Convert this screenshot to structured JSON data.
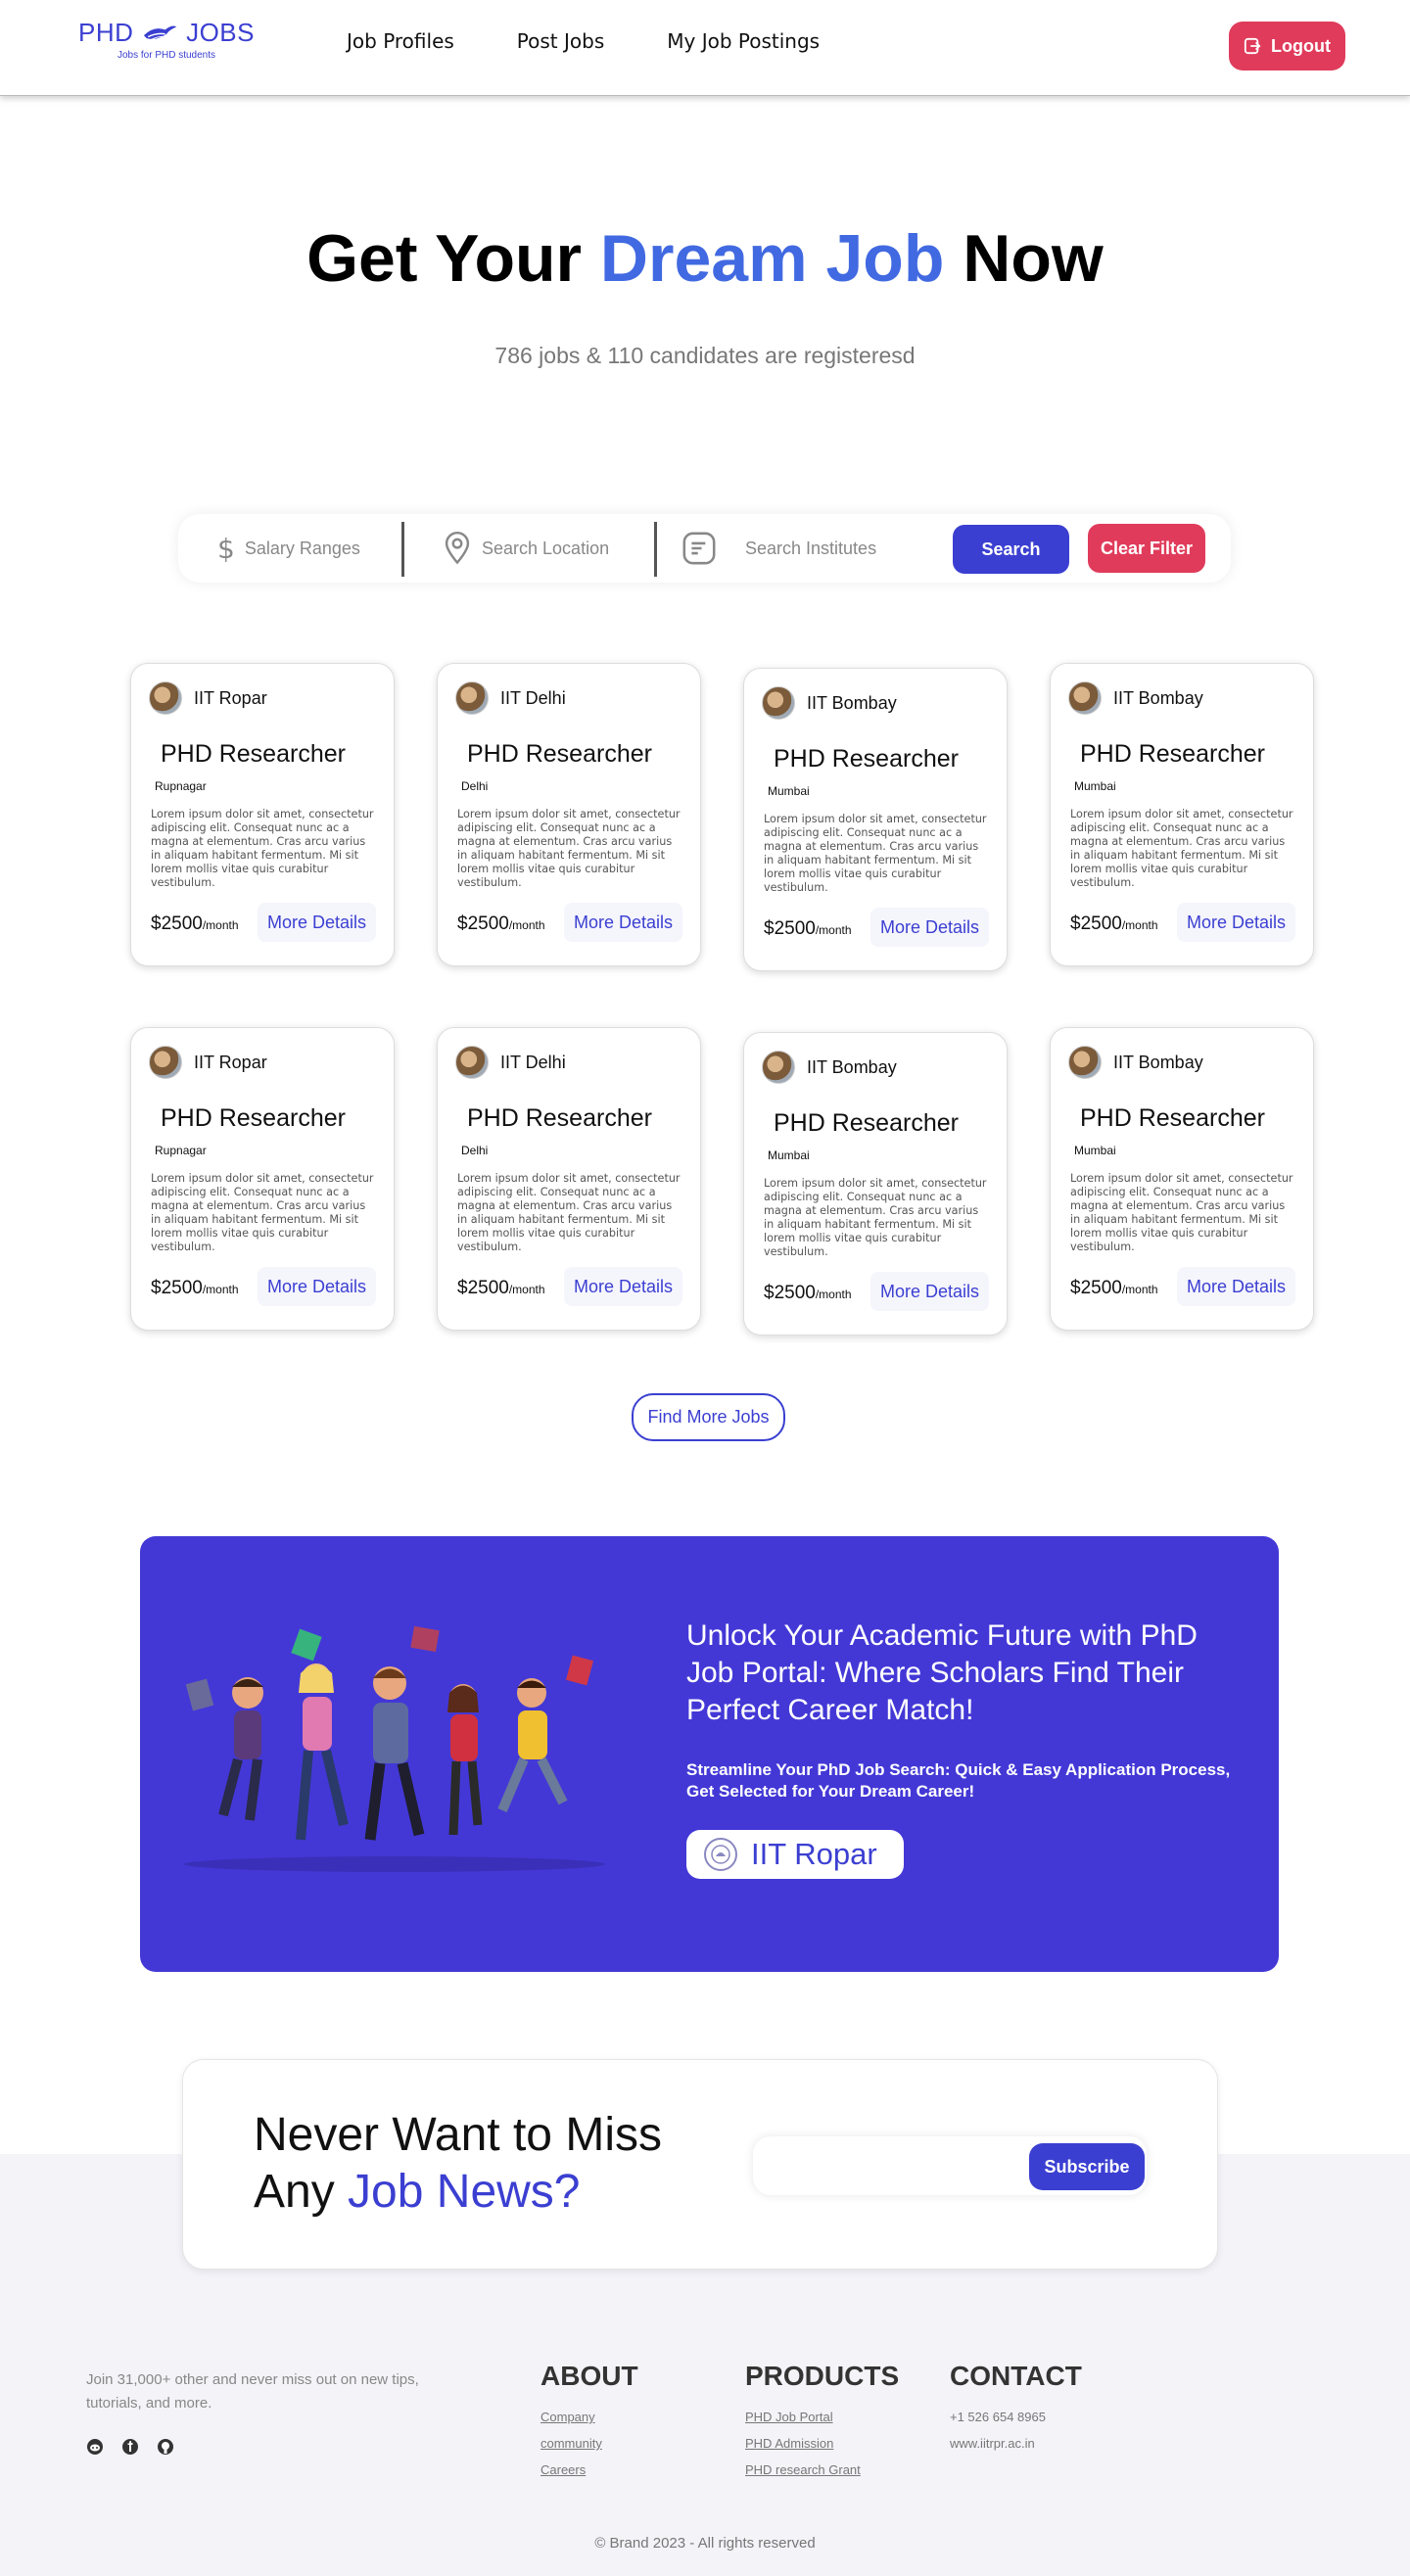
{
  "nav": {
    "logo_text_left": "PHD",
    "logo_text_right": "JOBS",
    "logo_tagline": "Jobs for PHD students",
    "links": [
      "Job Profiles",
      "Post Jobs",
      "My Job Postings"
    ],
    "logout_label": "Logout"
  },
  "hero": {
    "title_pre": "Get Your ",
    "title_accent": "Dream Job",
    "title_post": " Now",
    "subtitle": "786 jobs & 110 candidates are registeresd"
  },
  "search": {
    "salary_placeholder": "Salary Ranges",
    "location_placeholder": "Search Location",
    "institute_placeholder": "Search Institutes",
    "search_label": "Search",
    "clear_label": "Clear Filter"
  },
  "jobs": [
    {
      "institute": "IIT Ropar",
      "title": "PHD Researcher",
      "location": "Rupnagar",
      "description": "Lorem ipsum dolor sit amet, consectetur adipiscing elit. Consequat nunc ac a magna at elementum. Cras arcu varius in aliquam habitant fermentum. Mi sit lorem mollis vitae quis curabitur vestibulum.",
      "salary": "$2500",
      "per": "/month",
      "cta": "More Details"
    },
    {
      "institute": "IIT Delhi",
      "title": "PHD Researcher",
      "location": "Delhi",
      "description": "Lorem ipsum dolor sit amet, consectetur adipiscing elit. Consequat nunc ac a magna at elementum. Cras arcu varius in aliquam habitant fermentum. Mi sit lorem mollis vitae quis curabitur vestibulum.",
      "salary": "$2500",
      "per": "/month",
      "cta": "More Details"
    },
    {
      "institute": "IIT Bombay",
      "title": "PHD Researcher",
      "location": "Mumbai",
      "description": "Lorem ipsum dolor sit amet, consectetur adipiscing elit. Consequat nunc ac a magna at elementum. Cras arcu varius in aliquam habitant fermentum. Mi sit lorem mollis vitae quis curabitur vestibulum.",
      "salary": "$2500",
      "per": "/month",
      "cta": "More Details"
    },
    {
      "institute": "IIT Bombay",
      "title": "PHD Researcher",
      "location": "Mumbai",
      "description": "Lorem ipsum dolor sit amet, consectetur adipiscing elit. Consequat nunc ac a magna at elementum. Cras arcu varius in aliquam habitant fermentum. Mi sit lorem mollis vitae quis curabitur vestibulum.",
      "salary": "$2500",
      "per": "/month",
      "cta": "More Details"
    },
    {
      "institute": "IIT Ropar",
      "title": "PHD Researcher",
      "location": "Rupnagar",
      "description": "Lorem ipsum dolor sit amet, consectetur adipiscing elit. Consequat nunc ac a magna at elementum. Cras arcu varius in aliquam habitant fermentum. Mi sit lorem mollis vitae quis curabitur vestibulum.",
      "salary": "$2500",
      "per": "/month",
      "cta": "More Details"
    },
    {
      "institute": "IIT Delhi",
      "title": "PHD Researcher",
      "location": "Delhi",
      "description": "Lorem ipsum dolor sit amet, consectetur adipiscing elit. Consequat nunc ac a magna at elementum. Cras arcu varius in aliquam habitant fermentum. Mi sit lorem mollis vitae quis curabitur vestibulum.",
      "salary": "$2500",
      "per": "/month",
      "cta": "More Details"
    },
    {
      "institute": "IIT Bombay",
      "title": "PHD Researcher",
      "location": "Mumbai",
      "description": "Lorem ipsum dolor sit amet, consectetur adipiscing elit. Consequat nunc ac a magna at elementum. Cras arcu varius in aliquam habitant fermentum. Mi sit lorem mollis vitae quis curabitur vestibulum.",
      "salary": "$2500",
      "per": "/month",
      "cta": "More Details"
    },
    {
      "institute": "IIT Bombay",
      "title": "PHD Researcher",
      "location": "Mumbai",
      "description": "Lorem ipsum dolor sit amet, consectetur adipiscing elit. Consequat nunc ac a magna at elementum. Cras arcu varius in aliquam habitant fermentum. Mi sit lorem mollis vitae quis curabitur vestibulum.",
      "salary": "$2500",
      "per": "/month",
      "cta": "More Details"
    }
  ],
  "find_more_label": "Find More Jobs",
  "promo": {
    "title": "Unlock Your Academic Future with PhD Job Portal: Where Scholars Find Their Perfect Career Match!",
    "subtitle": "Streamline Your PhD Job Search: Quick & Easy Application Process, Get Selected for Your Dream Career!",
    "badge_label": "IIT Ropar",
    "background_color": "#4338d6"
  },
  "newsletter": {
    "title_line1": "Never Want to Miss",
    "title_line2_pre": "Any ",
    "title_line2_accent": "Job News?",
    "input_value": "",
    "subscribe_label": "Subscribe"
  },
  "footer": {
    "tagline": "Join 31,000+ other and never miss out on new tips, tutorials, and more.",
    "social_icons": [
      "reddit-icon",
      "facebook-icon",
      "github-icon"
    ],
    "about_heading": "ABOUT",
    "about_links": [
      "Company",
      "community",
      "Careers"
    ],
    "products_heading": "PRODUCTS",
    "products_links": [
      "PHD Job Portal",
      "PHD Admission",
      "PHD research Grant"
    ],
    "contact_heading": "CONTACT",
    "contact_phone": "+1 526 654 8965",
    "contact_web": "www.iitrpr.ac.in",
    "copyright": "© Brand 2023 - All rights reserved"
  },
  "colors": {
    "brand_blue": "#3b3fd1",
    "hero_accent": "#4169e1",
    "danger": "#e03b5b"
  }
}
